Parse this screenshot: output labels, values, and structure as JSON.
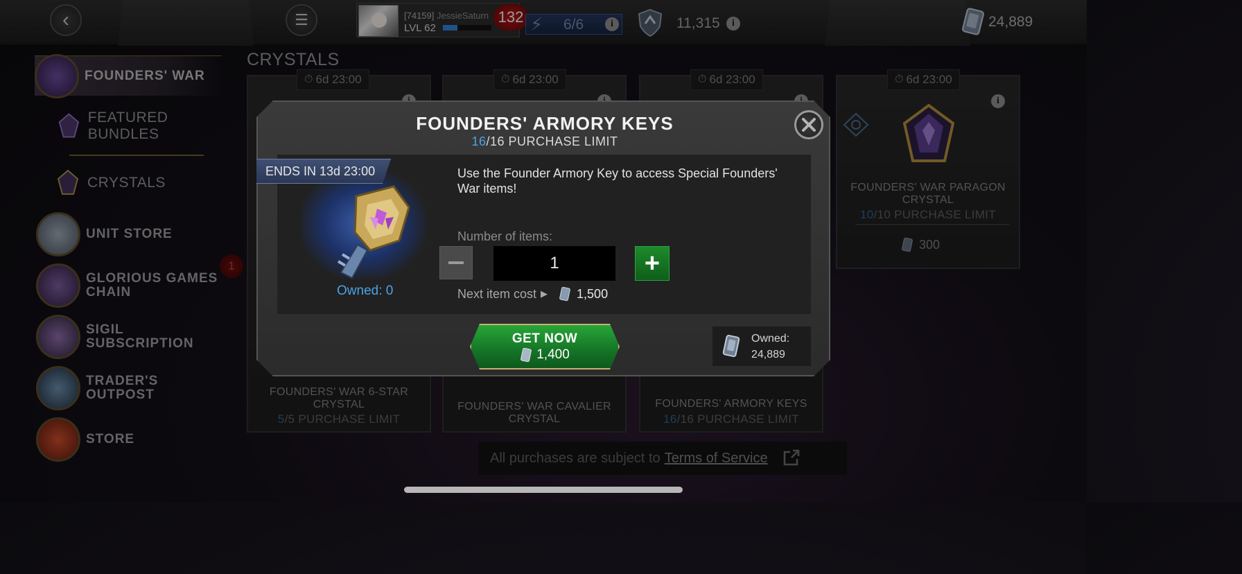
{
  "header": {
    "player_id": "[74159]",
    "player_name": "JessieSaturn",
    "level": "LVL 62",
    "level_progress": 0.3,
    "notifications": "132",
    "energy": "6/6",
    "shield_currency": "11,315",
    "units": "24,889"
  },
  "sidebar": {
    "items": [
      {
        "label": "FOUNDERS' WAR",
        "active": true
      },
      {
        "label": "FEATURED BUNDLES"
      },
      {
        "label": "CRYSTALS"
      },
      {
        "label": "UNIT STORE",
        "badge": "1"
      },
      {
        "label": "GLORIOUS GAMES CHAIN"
      },
      {
        "label": "SIGIL SUBSCRIPTION"
      },
      {
        "label": "TRADER'S OUTPOST"
      },
      {
        "label": "STORE"
      }
    ]
  },
  "main": {
    "section_title": "CRYSTALS",
    "cards": [
      {
        "timer": "6d 23:00",
        "title": "FOUNDERS' WAR 6-STAR CRYSTAL",
        "limit_current": "5",
        "limit_rest": "/5 PURCHASE LIMIT"
      },
      {
        "timer": "6d 23:00",
        "title": "FOUNDERS' WAR CAVALIER CRYSTAL",
        "limit_current": "",
        "limit_rest": ""
      },
      {
        "timer": "6d 23:00",
        "title": "FOUNDERS' ARMORY KEYS",
        "limit_current": "16",
        "limit_rest": "/16 PURCHASE LIMIT"
      },
      {
        "timer": "6d 23:00",
        "title": "FOUNDERS' WAR PARAGON CRYSTAL",
        "limit_current": "10",
        "limit_rest": "/10 PURCHASE LIMIT",
        "price": "300"
      }
    ],
    "tos_text": "All purchases are subject to",
    "tos_link": "Terms of Service"
  },
  "modal": {
    "title": "FOUNDERS' ARMORY KEYS",
    "limit_current": "16",
    "limit_rest": "/16 PURCHASE LIMIT",
    "ends_in": "ENDS IN 13d 23:00",
    "owned": "Owned: 0",
    "description": "Use the Founder Armory Key to access Special Founders' War items!",
    "number_label": "Number of items:",
    "quantity": "1",
    "next_cost_label": "Next item cost",
    "next_cost_value": "1,500",
    "get_now_label": "GET NOW",
    "get_now_price": "1,400",
    "owned_units_label": "Owned:",
    "owned_units_value": "24,889"
  },
  "icons": {
    "back": "back-arrow-icon",
    "menu": "hamburger-menu-icon",
    "info": "info-icon",
    "clock": "clock-icon",
    "close": "close-icon",
    "units": "units-currency-icon",
    "external": "external-link-icon"
  },
  "colors": {
    "accent_blue": "#4aa3e8",
    "button_green": "#157326",
    "badge_red": "#b01515",
    "gold_border": "#c9b074"
  }
}
